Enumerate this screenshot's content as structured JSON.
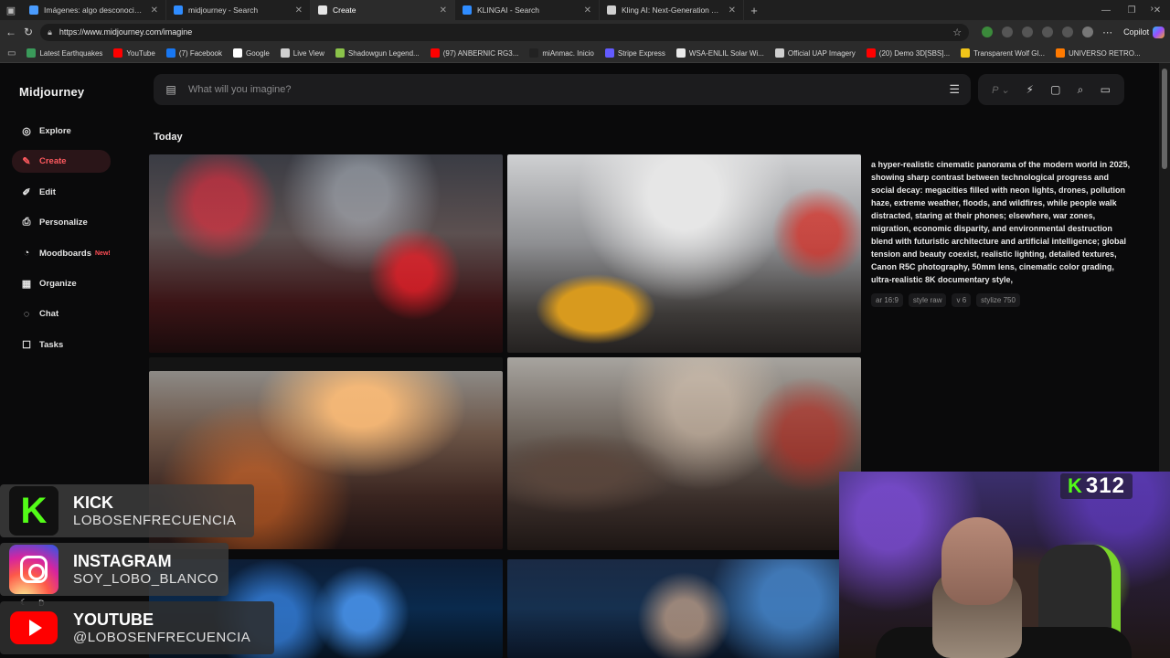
{
  "browser": {
    "tabs": [
      {
        "label": "Imágenes: algo desconocido para",
        "favicon_color": "#4a9cff",
        "active": false
      },
      {
        "label": "midjourney - Search",
        "favicon_color": "#2f8cff",
        "active": false
      },
      {
        "label": "Create",
        "favicon_color": "#e6e6e6",
        "active": true
      },
      {
        "label": "KLINGAI - Search",
        "favicon_color": "#2f8cff",
        "active": false
      },
      {
        "label": "Kling AI: Next-Generation AI Crea",
        "favicon_color": "#cfcfcf",
        "active": false
      }
    ],
    "url": "https://www.midjourney.com/imagine",
    "copilot_label": "Copilot",
    "bookmarks": [
      {
        "label": "Latest Earthquakes",
        "color": "#3a9a5a"
      },
      {
        "label": "YouTube",
        "color": "#ff0000"
      },
      {
        "label": "(7) Facebook",
        "color": "#1877f2"
      },
      {
        "label": "Google",
        "color": "#ffffff"
      },
      {
        "label": "Live View",
        "color": "#cfcfcf"
      },
      {
        "label": "Shadowgun Legend...",
        "color": "#8bc34a"
      },
      {
        "label": "(97) ANBERNIC RG3...",
        "color": "#ff0000"
      },
      {
        "label": "miAnmac. Inicio",
        "color": "#222222"
      },
      {
        "label": "Stripe Express",
        "color": "#635bff"
      },
      {
        "label": "WSA-ENLIL Solar Wi...",
        "color": "#eaeaea"
      },
      {
        "label": "Official UAP Imagery",
        "color": "#cfcfcf"
      },
      {
        "label": "(20) Demo 3D[SBS]...",
        "color": "#ff0000"
      },
      {
        "label": "Transparent Wolf Gl...",
        "color": "#f0c419"
      },
      {
        "label": "UNIVERSO RETRO...",
        "color": "#ff7a00"
      }
    ]
  },
  "app": {
    "logo": "Midjourney",
    "nav": [
      {
        "label": "Explore",
        "icon": "compass-icon",
        "active": false
      },
      {
        "label": "Create",
        "icon": "brush-icon",
        "active": true
      },
      {
        "label": "Edit",
        "icon": "edit-icon",
        "active": false
      },
      {
        "label": "Personalize",
        "icon": "personalize-icon",
        "active": false
      },
      {
        "label": "Moodboards",
        "icon": "moodboard-icon",
        "active": false,
        "badge": "New!"
      },
      {
        "label": "Organize",
        "icon": "grid-icon",
        "active": false
      },
      {
        "label": "Chat",
        "icon": "chat-icon",
        "active": false
      },
      {
        "label": "Tasks",
        "icon": "tasks-icon",
        "active": false
      }
    ],
    "search_placeholder": "What will you imagine?",
    "section_title": "Today",
    "prompt": "a hyper-realistic cinematic panorama of the modern world in 2025, showing sharp contrast between technological progress and social decay: megacities filled with neon lights, drones, pollution haze, extreme weather, floods, and wildfires, while people walk distracted, staring at their phones; elsewhere, war zones, migration, economic disparity, and environmental destruction blend with futuristic architecture and artificial intelligence; global tension and beauty coexist, realistic lighting, detailed textures, Canon R5C photography, 50mm lens, cinematic color grading, ultra-realistic 8K documentary style,",
    "params": [
      "ar 16:9",
      "style raw",
      "v 6",
      "stylize 750"
    ],
    "accent": "#ff5a5f"
  },
  "overlay": {
    "kick": {
      "network": "KICK",
      "handle": "LOBOSENFRECUENCIA"
    },
    "instagram": {
      "network": "INSTAGRAM",
      "handle": "SOY_LOBO_BLANCO"
    },
    "youtube": {
      "network": "YOUTUBE",
      "handle": "@LOBOSENFRECUENCIA"
    },
    "viewer_count": "312",
    "partial_letter": "D"
  }
}
